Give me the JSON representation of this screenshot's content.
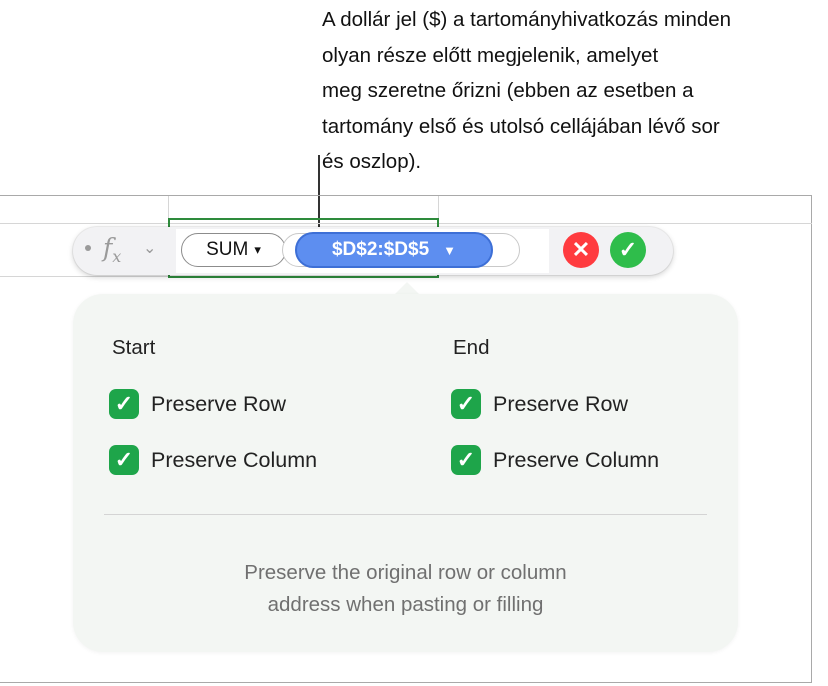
{
  "callout": {
    "lines": [
      "A dollár jel ($) a tartományhivatkozás minden",
      "olyan része előtt megjelenik, amelyet",
      "meg szeretne őrizni (ebben az esetben a",
      "tartomány első és utolsó cellájában lévő sor",
      "és oszlop)."
    ]
  },
  "formula_bar": {
    "fx_label": "f",
    "fx_sub": "x",
    "chevron_glyph": "⌄",
    "function_token": "SUM",
    "function_caret": "▾",
    "range_token": "$D$2:$D$5",
    "range_caret": "▼",
    "cancel_glyph": "✕",
    "accept_glyph": "✓"
  },
  "popover": {
    "start": {
      "heading": "Start",
      "options": [
        {
          "label": "Preserve Row",
          "checked": true
        },
        {
          "label": "Preserve Column",
          "checked": true
        }
      ]
    },
    "end": {
      "heading": "End",
      "options": [
        {
          "label": "Preserve Row",
          "checked": true
        },
        {
          "label": "Preserve Column",
          "checked": true
        }
      ]
    },
    "check_glyph": "✓",
    "help_lines": [
      "Preserve the original row or column",
      "address when pasting or filling"
    ]
  },
  "colors": {
    "range_token": "#5d8ef0",
    "checkbox": "#1ea54a",
    "cancel": "#ff3b3f",
    "accept": "#2fbd4b",
    "selection_border": "#2e8b3c"
  }
}
